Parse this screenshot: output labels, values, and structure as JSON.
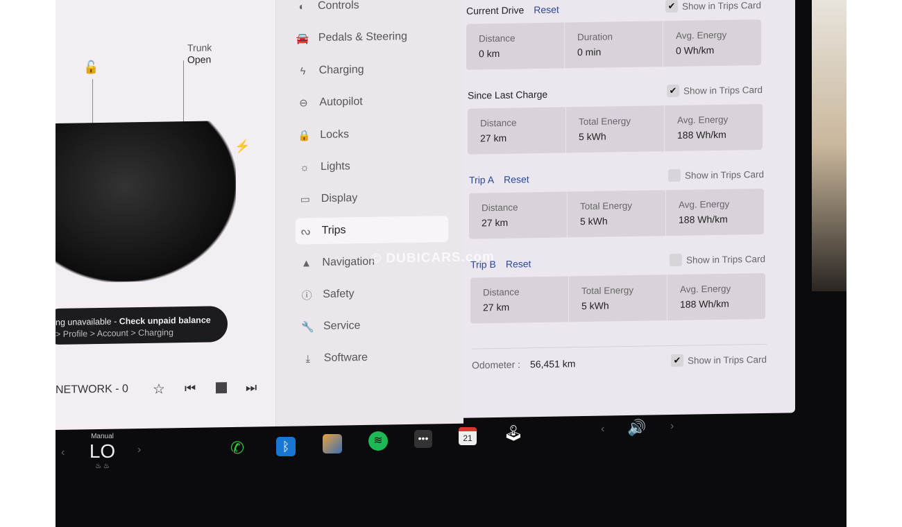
{
  "left_panel": {
    "trunk_label": "Trunk",
    "trunk_status": "Open",
    "notification_line1_prefix": "ng unavailable - ",
    "notification_line1_link": "Check unpaid balance",
    "notification_line2": "> Profile > Account > Charging",
    "media_title": "NETWORK - 0"
  },
  "menu": {
    "items": [
      {
        "label": "Controls",
        "icon": "toggle-icon"
      },
      {
        "label": "Pedals & Steering",
        "icon": "car-icon"
      },
      {
        "label": "Charging",
        "icon": "bolt-icon"
      },
      {
        "label": "Autopilot",
        "icon": "steering-wheel-icon"
      },
      {
        "label": "Locks",
        "icon": "lock-icon"
      },
      {
        "label": "Lights",
        "icon": "sun-icon"
      },
      {
        "label": "Display",
        "icon": "display-icon"
      },
      {
        "label": "Trips",
        "icon": "trips-icon",
        "selected": true
      },
      {
        "label": "Navigation",
        "icon": "navigation-icon"
      },
      {
        "label": "Safety",
        "icon": "alert-icon"
      },
      {
        "label": "Service",
        "icon": "wrench-icon"
      },
      {
        "label": "Software",
        "icon": "download-icon"
      }
    ]
  },
  "trips": {
    "show_label": "Show in Trips Card",
    "reset_label": "Reset",
    "sections": [
      {
        "title": "Current Drive",
        "reset": true,
        "show": true,
        "cells": [
          {
            "label": "Distance",
            "value": "0  km"
          },
          {
            "label": "Duration",
            "value": "0  min"
          },
          {
            "label": "Avg. Energy",
            "value": "0  Wh/km"
          }
        ]
      },
      {
        "title": "Since Last Charge",
        "reset": false,
        "show": true,
        "cells": [
          {
            "label": "Distance",
            "value": "27  km"
          },
          {
            "label": "Total Energy",
            "value": "5  kWh"
          },
          {
            "label": "Avg. Energy",
            "value": "188  Wh/km"
          }
        ]
      },
      {
        "title": "Trip A",
        "reset": true,
        "show": false,
        "cells": [
          {
            "label": "Distance",
            "value": "27  km"
          },
          {
            "label": "Total Energy",
            "value": "5  kWh"
          },
          {
            "label": "Avg. Energy",
            "value": "188  Wh/km"
          }
        ]
      },
      {
        "title": "Trip B",
        "reset": true,
        "show": false,
        "cells": [
          {
            "label": "Distance",
            "value": "27  km"
          },
          {
            "label": "Total Energy",
            "value": "5  kWh"
          },
          {
            "label": "Avg. Energy",
            "value": "188  Wh/km"
          }
        ]
      }
    ],
    "odometer_label": "Odometer",
    "odometer_value": "56,451 km",
    "odometer_show": true
  },
  "bottom_bar": {
    "climate_mode": "Manual",
    "temperature": "LO",
    "calendar_day": "21"
  },
  "watermark": "© DUBICARS.com",
  "colors": {
    "accent": "#2a4a9a",
    "phone": "#2ecc40",
    "spotify": "#1db954",
    "bluetooth": "#1976d2"
  }
}
